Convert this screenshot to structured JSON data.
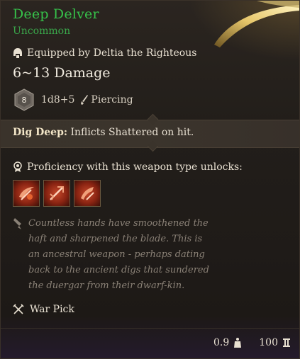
{
  "item": {
    "name": "Deep Delver",
    "rarity": "Uncommon",
    "equipped_by": "Equipped by Deltia the Righteous",
    "damage": "6~13 Damage",
    "dice_value": "8",
    "damage_dice": "1d8+5",
    "damage_type": "Piercing"
  },
  "action": {
    "name": "Dig Deep:",
    "description": " Inflicts Shattered on hit."
  },
  "proficiency": {
    "label": "Proficiency with this weapon type unlocks:",
    "icons": [
      "action-icon-1",
      "action-icon-2",
      "action-icon-3"
    ]
  },
  "lore": "Countless hands have smoothened the haft and sharpened the blade. This is an ancestral weapon - perhaps dating back to the ancient digs that sundered the duergar from their dwarf-kin.",
  "weapon_type": "War Pick",
  "footer": {
    "weight": "0.9",
    "value": "100"
  },
  "colors": {
    "name": "#36c24a",
    "rarity": "#3aa84b",
    "lore": "#8a8176",
    "action_icon": "#c5482a"
  }
}
